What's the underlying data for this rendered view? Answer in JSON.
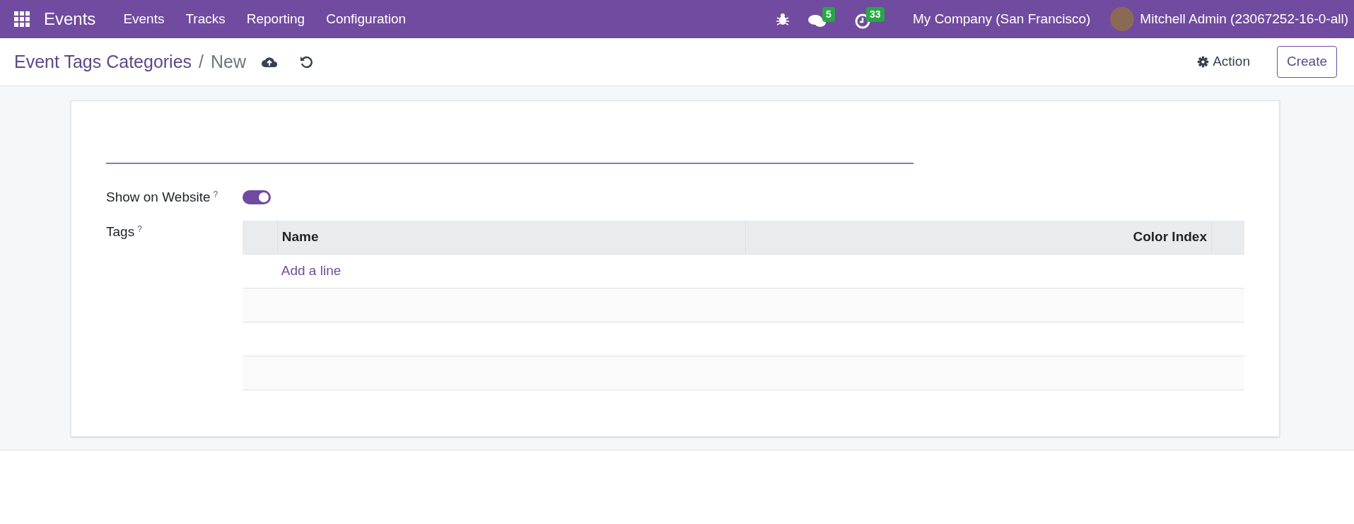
{
  "navbar": {
    "app_name": "Events",
    "menu": [
      "Events",
      "Tracks",
      "Reporting",
      "Configuration"
    ],
    "messages_count": "5",
    "activities_count": "33",
    "company": "My Company (San Francisco)",
    "user": "Mitchell Admin (23067252-16-0-all)"
  },
  "control_panel": {
    "breadcrumb": "Event Tags Categories",
    "separator": "/",
    "current": "New",
    "action_label": "Action",
    "create_label": "Create"
  },
  "form": {
    "fields": [
      {
        "kind": "toggle",
        "label": "Show on Website",
        "help": "?",
        "on": true
      },
      {
        "kind": "list",
        "label": "Tags",
        "help": "?",
        "columns": [
          "Name",
          "Color Index"
        ],
        "add_line": "Add a line"
      }
    ]
  }
}
